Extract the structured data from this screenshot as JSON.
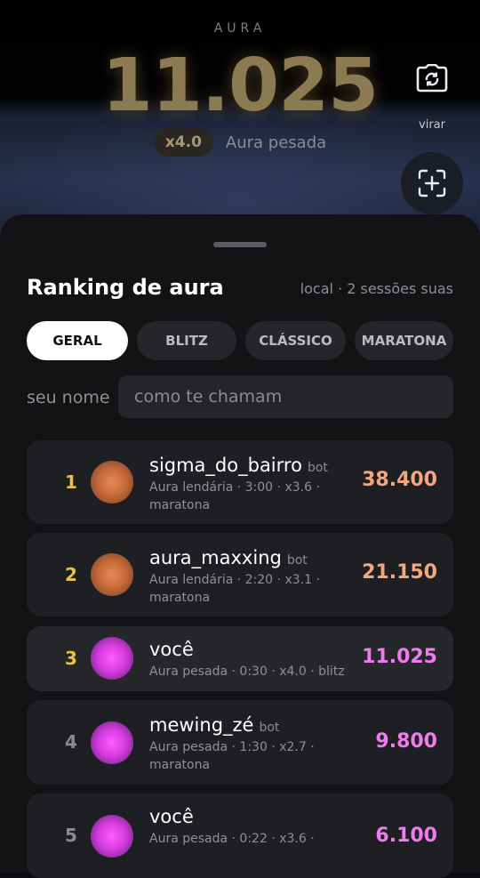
{
  "header": {
    "aura_label": "AURA",
    "score": "11.025",
    "multiplier": "x4.0",
    "tier": "Aura pesada",
    "flip_label": "virar",
    "flip_icon": "camera-flip-icon",
    "scan_icon": "scan-plus-icon"
  },
  "ranking": {
    "title": "Ranking de aura",
    "subtitle": "local · 2 sessões suas",
    "tabs": [
      {
        "label": "GERAL",
        "active": true
      },
      {
        "label": "BLITZ",
        "active": false
      },
      {
        "label": "CLÁSSICO",
        "active": false
      },
      {
        "label": "MARATONA",
        "active": false
      }
    ],
    "name_label": "seu nome",
    "name_placeholder": "como te chamam",
    "bot_tag": "bot",
    "entries": [
      {
        "rank": "1",
        "name": "sigma_do_bairro",
        "bot": true,
        "detail": "Aura lendária · 3:00 · x3.6 · maratona",
        "score": "38.400",
        "color": "#f4a77e"
      },
      {
        "rank": "2",
        "name": "aura_maxxing",
        "bot": true,
        "detail": "Aura lendária · 2:20 · x3.1 · maratona",
        "score": "21.150",
        "color": "#f4a77e"
      },
      {
        "rank": "3",
        "name": "você",
        "bot": false,
        "detail": "Aura pesada · 0:30 · x4.0 · blitz",
        "score": "11.025",
        "color": "#ee7cee"
      },
      {
        "rank": "4",
        "name": "mewing_zé",
        "bot": true,
        "detail": "Aura pesada · 1:30 · x2.7 · maratona",
        "score": "9.800",
        "color": "#ee7cee"
      },
      {
        "rank": "5",
        "name": "você",
        "bot": false,
        "detail": "Aura pesada · 0:22 · x3.6 ·",
        "score": "6.100",
        "color": "#ee7cee"
      }
    ]
  }
}
